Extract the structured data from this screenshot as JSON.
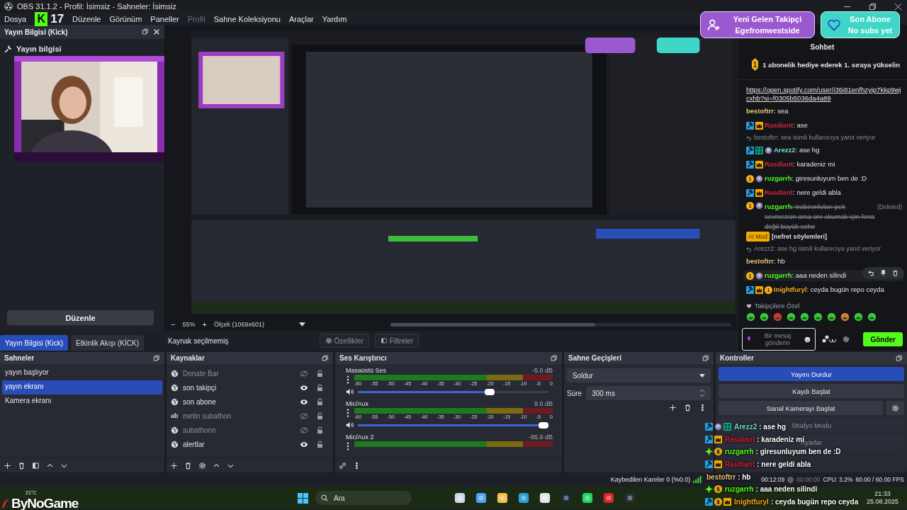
{
  "window": {
    "title": "OBS 31.1.2 - Profil: İsimsiz - Sahneler: İsimsiz"
  },
  "menu": [
    {
      "label": "Dosya",
      "disabled": false
    },
    {
      "label": "Düzenle",
      "disabled": false
    },
    {
      "label": "Görünüm",
      "disabled": false
    },
    {
      "label": "Paneller",
      "disabled": false
    },
    {
      "label": "Profil",
      "disabled": true
    },
    {
      "label": "Sahne Koleksiyonu",
      "disabled": false
    },
    {
      "label": "Araçlar",
      "disabled": false
    },
    {
      "label": "Yardım",
      "disabled": false
    }
  ],
  "info_dock": {
    "title": "Yayın Bilgisi (Kick)",
    "heading": "Yayın bilgisi",
    "edit_button": "Düzenle"
  },
  "preview": {
    "kind": "picture",
    "zoom_out": "−",
    "zoom": "55%",
    "zoom_in": "+",
    "scale": "Ölçek (1069x601)"
  },
  "dock_tabs": [
    {
      "label": "Yayın Bilgisi (Kick)",
      "selected": true
    },
    {
      "label": "Etkinlik Akışı (KİCK)",
      "selected": false
    }
  ],
  "source_toolbar": {
    "status": "Kaynak seçilmemiş",
    "properties": "Özellikler",
    "filters": "Filtreler"
  },
  "chat": {
    "title": "Sohbet",
    "pinned_rank": "1",
    "pinned": "1 abonelik hediye ederek 1. sıraya yükselin",
    "messages": [
      {
        "kind": "link",
        "text": "https://open.spotify.com/user/i36i81enfhzyip7kkp9wjcxhb?si=f0305b5036da4a89"
      },
      {
        "kind": "message",
        "user": "bestoftrr",
        "color": "#e8c27a",
        "text": ": sea",
        "deleted": false,
        "highlighted": false
      },
      {
        "kind": "message",
        "user": "Rasdiant",
        "color": "#d0243c",
        "text": ": ase",
        "badges": [
          {
            "kind": "mod"
          },
          {
            "kind": "crown"
          }
        ],
        "deleted": false,
        "highlighted": false
      },
      {
        "kind": "reply",
        "text": "bestoftrr: sea isimli kullanıcıya yanıt veriyor"
      },
      {
        "kind": "message",
        "user": "Arezz2",
        "color": "#6ee0c8",
        "text": ": ase hg",
        "badges": [
          {
            "kind": "mod"
          },
          {
            "kind": "og"
          },
          {
            "kind": "avatar"
          }
        ],
        "deleted": false,
        "highlighted": false
      },
      {
        "kind": "message",
        "user": "Rasdiant",
        "color": "#d0243c",
        "text": ": karadeniz mi",
        "badges": [
          {
            "kind": "mod"
          },
          {
            "kind": "crown"
          }
        ],
        "deleted": false,
        "highlighted": false
      },
      {
        "kind": "message",
        "user": "ruzgarrh",
        "color": "#53fc18",
        "text": ": giresunluyum ben de :D",
        "badges": [
          {
            "kind": "sub",
            "label": "1"
          },
          {
            "kind": "avatar"
          }
        ],
        "deleted": false,
        "highlighted": false
      },
      {
        "kind": "message",
        "user": "Rasdiant",
        "color": "#d0243c",
        "text": ": nere geldi abla",
        "badges": [
          {
            "kind": "mod"
          },
          {
            "kind": "crown"
          }
        ],
        "deleted": false,
        "highlighted": false
      },
      {
        "kind": "message",
        "user": "ruzgarrh",
        "color": "#53fc18",
        "text": ": trabzonluları pek sevmezsin ama üni okumak için fena değil büyük sehir",
        "badges": [
          {
            "kind": "sub",
            "label": "1"
          },
          {
            "kind": "avatar"
          }
        ],
        "deleted": true,
        "deleted_label": "(Deleted)",
        "mod_tag": "AI Mod",
        "reason": "[nefret söylemleri]",
        "highlighted": false
      },
      {
        "kind": "reply",
        "text": "Arezz2: ase hg isimli kullanıcıya yanıt veriyor"
      },
      {
        "kind": "message",
        "user": "bestoftrr",
        "color": "#e8c27a",
        "text": ": hb",
        "deleted": false,
        "highlighted": false
      },
      {
        "kind": "message",
        "user": "ruzgarrh",
        "color": "#53fc18",
        "text": ": aaa neden silindi",
        "badges": [
          {
            "kind": "sub",
            "label": "1"
          },
          {
            "kind": "avatar"
          }
        ],
        "deleted": false,
        "highlighted": true
      },
      {
        "kind": "message",
        "user": "Inightfuryl",
        "color": "#f5a623",
        "text": ": ceyda bugün repo ceyda",
        "badges": [
          {
            "kind": "mod"
          },
          {
            "kind": "crown"
          },
          {
            "kind": "sub",
            "label": "1"
          }
        ],
        "deleted": false,
        "highlighted": false
      }
    ],
    "emote_title": "Takipçilere Özel",
    "input_placeholder": "Bir mesaj gönderin",
    "send": "Gönder"
  },
  "scenes": {
    "title": "Sahneler",
    "items": [
      {
        "name": "yayın başlıyor",
        "selected": false
      },
      {
        "name": "yayın ekranı",
        "selected": true
      },
      {
        "name": "Kamera ekranı",
        "selected": false
      }
    ]
  },
  "sources": {
    "title": "Kaynaklar",
    "items": [
      {
        "name": "Donate Bar",
        "kind": "browser",
        "visible": false
      },
      {
        "name": "son takipçi",
        "kind": "browser",
        "visible": true
      },
      {
        "name": "son abone",
        "kind": "browser",
        "visible": true
      },
      {
        "name": "metin subathon",
        "kind": "text",
        "icon_label": "ab",
        "visible": false
      },
      {
        "name": "subathonn",
        "kind": "browser",
        "visible": false
      },
      {
        "name": "alertlar",
        "kind": "browser",
        "visible": true
      }
    ]
  },
  "mixer": {
    "title": "Ses Karıştırıcı",
    "channels": [
      {
        "name": "Masaüstü Ses",
        "reading": "-5.0 dB",
        "level": 0.7,
        "scale": [
          "-60",
          "-55",
          "-50",
          "-45",
          "-40",
          "-35",
          "-30",
          "-25",
          "-20",
          "-15",
          "-10",
          "-5",
          "0"
        ]
      },
      {
        "name": "Mic/Aux",
        "reading": "9.0 dB",
        "level": 1,
        "scale": [
          "-60",
          "-55",
          "-50",
          "-45",
          "-40",
          "-35",
          "-30",
          "-25",
          "-20",
          "-15",
          "-10",
          "-5",
          "0"
        ]
      },
      {
        "name": "Mic/Aux 2",
        "reading": "-95.9 dB"
      }
    ]
  },
  "transitions": {
    "title": "Sahne Geçişleri",
    "transition": "Soldur",
    "duration_label": "Süre",
    "duration": "300 ms"
  },
  "controls": {
    "title": "Kontroller",
    "buttons": [
      {
        "label": "Yayını Durdur",
        "active": true
      },
      {
        "label": "Kaydı Başlat",
        "active": false
      },
      {
        "label": "Sanal Kamerayı Başlat",
        "active": false
      },
      {
        "label": "Stüdyo Modu",
        "active": false
      },
      {
        "label": "Ayarlar",
        "active": false
      }
    ]
  },
  "status_bar": {
    "dropped": "Kaybedilen Kareler 0 (%0.0)",
    "stream_time": "00:12:09",
    "record_time": "00:00:00",
    "cpu": "CPU: 3.2%",
    "fps": "60.00 / 60.00 FPS"
  },
  "taskbar": {
    "search": "Ara",
    "time": "21:33",
    "date": "25.08.2025"
  },
  "stream_overlay": {
    "kick_logo": "K",
    "follower_count": "17",
    "new_follower": {
      "title": "Yeni Gelen Takipçi",
      "name": "Egefromwestside"
    },
    "last_sub": {
      "title": "Son Abone",
      "name": "No subs yet"
    },
    "logo": "ByNoGame",
    "weather": "21°C",
    "chat": [
      {
        "user": "Arezz2",
        "color": "#6ee0c8",
        "text": ": ase hg",
        "badges": [
          {
            "kind": "mod"
          },
          {
            "kind": "avatar"
          },
          {
            "kind": "og"
          }
        ]
      },
      {
        "user": "Rasdiant",
        "color": "#d0243c",
        "text": ": karadeniz mi",
        "badges": [
          {
            "kind": "mod"
          },
          {
            "kind": "crown"
          }
        ]
      },
      {
        "user": "ruzgarrh",
        "color": "#53fc18",
        "text": ": giresunluyum ben de :D",
        "badges": [
          {
            "kind": "sparkle"
          },
          {
            "kind": "sub",
            "label": "1"
          }
        ]
      },
      {
        "user": "Rasdiant",
        "color": "#d0243c",
        "text": ": nere geldi abla",
        "badges": [
          {
            "kind": "mod"
          },
          {
            "kind": "crown"
          }
        ]
      },
      {
        "user": "bestoftrr",
        "color": "#e8c27a",
        "text": ": hb"
      },
      {
        "user": "ruzgarrh",
        "color": "#53fc18",
        "text": ": aaa neden silindi",
        "badges": [
          {
            "kind": "sparkle"
          },
          {
            "kind": "sub",
            "label": "1"
          }
        ]
      },
      {
        "user": "Inightfuryl",
        "color": "#f5a623",
        "text": ": ceyda bugün repo ceyda",
        "badges": [
          {
            "kind": "mod"
          },
          {
            "kind": "sub",
            "label": "1"
          },
          {
            "kind": "crown"
          }
        ]
      }
    ]
  }
}
